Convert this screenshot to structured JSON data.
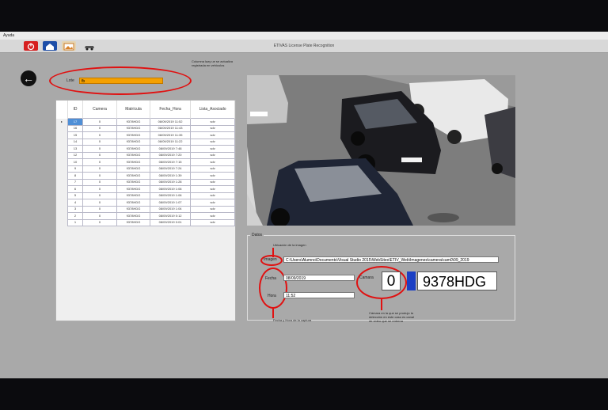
{
  "menu": {
    "label": "Ayuda"
  },
  "window_title": "ETIVAS License Plate Recognition",
  "toolbar": {
    "icons": [
      "power-icon",
      "home-icon",
      "image-icon",
      "car-icon"
    ]
  },
  "lote": {
    "label": "Lote",
    "value": "fb"
  },
  "annotations": {
    "top": "Columna lazy ue se actualiza registrada en vehículos",
    "ubicacion": "Ubicación de la imagen",
    "fecha_hora": "Fecha y Hora de la captura",
    "camera": "Cámara en la que se produjo la detección en este caso es canal de video que se entrena"
  },
  "grid": {
    "columns": [
      "ID",
      "Camera",
      "Matrícula",
      "Fecha_Hora",
      "Lista_Asociado"
    ],
    "rows": [
      [
        "17",
        "0",
        "9378HDG",
        "08/09/2019 11:52",
        "sdv"
      ],
      [
        "16",
        "0",
        "9378HDG",
        "08/09/2019 11:43",
        "sdv"
      ],
      [
        "15",
        "0",
        "9378HDG",
        "08/09/2019 11:35",
        "sdv"
      ],
      [
        "14",
        "0",
        "9378HDG",
        "08/09/2019 11:22",
        "sdv"
      ],
      [
        "13",
        "0",
        "9378HDG",
        "08/09/2019 7:48",
        "sdv"
      ],
      [
        "12",
        "0",
        "9378HDG",
        "08/09/2019 7:20",
        "sdv"
      ],
      [
        "10",
        "0",
        "9378HDG",
        "08/09/2019 7:15",
        "sdv"
      ],
      [
        "9",
        "0",
        "9378HDG",
        "08/09/2019 7:24",
        "sdv"
      ],
      [
        "8",
        "0",
        "9378HDG",
        "08/09/2019 1:39",
        "sdv"
      ],
      [
        "7",
        "0",
        "9378HDG",
        "08/09/2019 1:28",
        "sdv"
      ],
      [
        "6",
        "0",
        "9378HDG",
        "08/09/2019 1:06",
        "sdv"
      ],
      [
        "5",
        "0",
        "9378HDG",
        "08/09/2019 1:06",
        "sdv"
      ],
      [
        "4",
        "0",
        "9378HDG",
        "08/09/2019 1:07",
        "sdv"
      ],
      [
        "3",
        "0",
        "9378HDG",
        "08/09/2019 1:04",
        "sdv"
      ],
      [
        "2",
        "0",
        "9378HDG",
        "08/09/2019 0:12",
        "sdv"
      ],
      [
        "1",
        "0",
        "9378HDG",
        "08/09/2019 0:01",
        "sdv"
      ]
    ]
  },
  "datos": {
    "title": "Datos",
    "imagen_label": "Imagen",
    "imagen_value": "C:\\Users\\Alumno\\Documents\\Visual Studio 2015\\WebSites\\ETIV_Web\\Imagenes\\camera\\cam0\\09_2019",
    "fecha_label": "Fecha",
    "fecha_value": "08/09/2019",
    "hora_label": "Hora",
    "hora_value": "11:52",
    "camara_label": "Camara",
    "camara_value": "0",
    "plate": "9378HDG"
  }
}
